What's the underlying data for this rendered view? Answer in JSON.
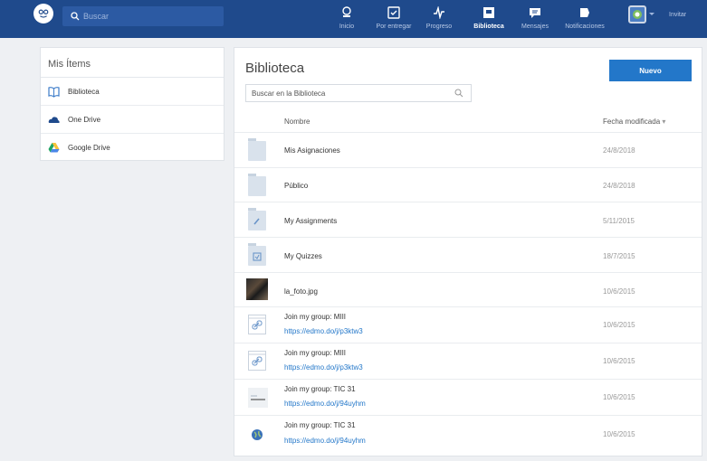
{
  "topbar": {
    "search_placeholder": "Buscar",
    "nav": [
      {
        "label": "Inicio",
        "icon": "home-icon"
      },
      {
        "label": "Por entregar",
        "icon": "inbox-icon"
      },
      {
        "label": "Progreso",
        "icon": "progress-icon"
      },
      {
        "label": "Biblioteca",
        "icon": "library-icon",
        "active": true
      },
      {
        "label": "Mensajes",
        "icon": "messages-icon"
      },
      {
        "label": "Notificaciones",
        "icon": "notifications-icon"
      }
    ],
    "invite_label": "Invitar"
  },
  "sidebar": {
    "title": "Mis Ítems",
    "items": [
      {
        "label": "Biblioteca",
        "icon": "book-icon"
      },
      {
        "label": "One Drive",
        "icon": "cloud-icon"
      },
      {
        "label": "Google Drive",
        "icon": "google-drive-icon"
      }
    ]
  },
  "main": {
    "title": "Biblioteca",
    "new_button": "Nuevo",
    "search_placeholder": "Buscar en la Biblioteca",
    "columns": {
      "name": "Nombre",
      "date": "Fecha modificada",
      "sort_indicator": "▾"
    },
    "rows": [
      {
        "type": "folder",
        "name": "Mis Asignaciones",
        "date": "24/8/2018"
      },
      {
        "type": "folder",
        "name": "Público",
        "date": "24/8/2018"
      },
      {
        "type": "folder",
        "name": "My Assignments",
        "date": "5/11/2015"
      },
      {
        "type": "folder",
        "name": "My Quizzes",
        "date": "18/7/2015"
      },
      {
        "type": "image",
        "name": "la_foto.jpg",
        "date": "10/6/2015"
      },
      {
        "type": "link",
        "name": "Join my group: MIII",
        "url": "https://edmo.do/j/p3ktw3",
        "date": "10/6/2015"
      },
      {
        "type": "link",
        "name": "Join my group: MIII",
        "url": "https://edmo.do/j/p3ktw3",
        "date": "10/6/2015"
      },
      {
        "type": "link",
        "name": "Join my group: TIC 31",
        "url": "https://edmo.do/j/94uyhm",
        "date": "10/6/2015"
      },
      {
        "type": "link",
        "name": "Join my group: TIC 31",
        "url": "https://edmo.do/j/94uyhm",
        "date": "10/6/2015"
      }
    ]
  }
}
